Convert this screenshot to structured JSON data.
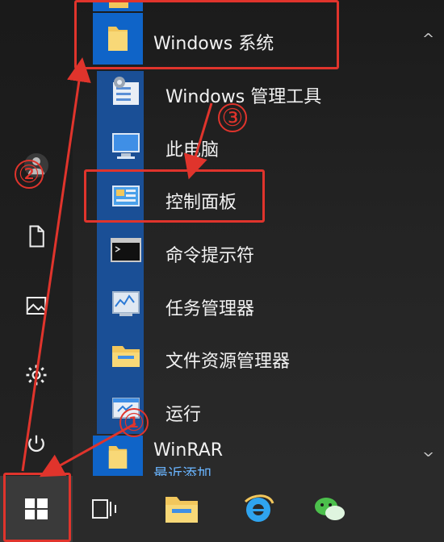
{
  "menu": {
    "group_header": "Windows 系统",
    "items": [
      {
        "label": "Windows 管理工具",
        "icon": "admin-tools-icon"
      },
      {
        "label": "此电脑",
        "icon": "this-pc-icon"
      },
      {
        "label": "控制面板",
        "icon": "control-panel-icon"
      },
      {
        "label": "命令提示符",
        "icon": "cmd-icon"
      },
      {
        "label": "任务管理器",
        "icon": "task-manager-icon"
      },
      {
        "label": "文件资源管理器",
        "icon": "file-explorer-icon"
      },
      {
        "label": "运行",
        "icon": "run-icon"
      }
    ],
    "next_group": {
      "label": "WinRAR",
      "subtitle": "最近添加"
    }
  },
  "annotations": {
    "step1": "①",
    "step2": "②",
    "step3": "③",
    "color": "#e0342c"
  },
  "colors": {
    "tile_blue": "#0f64c8",
    "link_blue": "#6ab5ff"
  }
}
